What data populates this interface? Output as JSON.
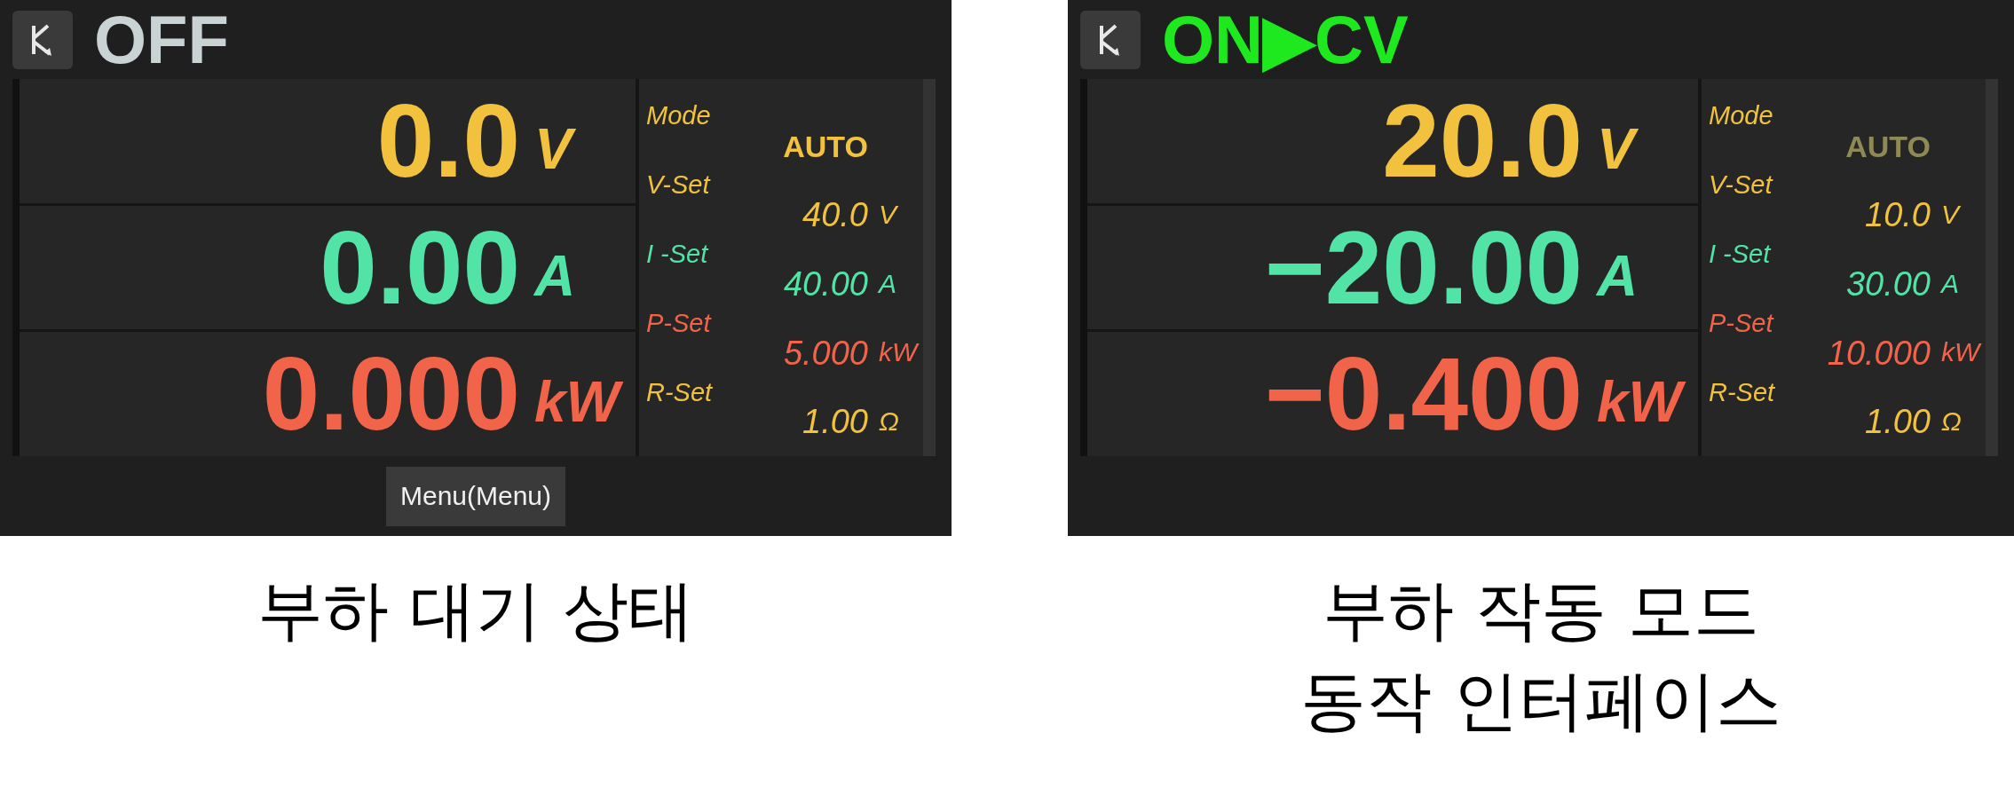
{
  "panels": [
    {
      "status": {
        "text": "OFF",
        "output_on": false
      },
      "readouts": [
        {
          "kind": "voltage",
          "value": "0.0",
          "unit": "V"
        },
        {
          "kind": "current",
          "value": "0.00",
          "unit": "A"
        },
        {
          "kind": "power",
          "value": "0.000",
          "unit": "kW"
        }
      ],
      "setting_labels": [
        {
          "kind": "mode",
          "text": "Mode"
        },
        {
          "kind": "voltage",
          "text": "V-Set"
        },
        {
          "kind": "current",
          "text": "I -Set"
        },
        {
          "kind": "power",
          "text": "P-Set"
        },
        {
          "kind": "resistance",
          "text": "R-Set"
        }
      ],
      "setting_values": [
        {
          "kind": "mode",
          "value": "AUTO",
          "dimmed": false
        },
        {
          "kind": "voltage",
          "value": "40.0",
          "unit": "V"
        },
        {
          "kind": "current",
          "value": "40.00",
          "unit": "A"
        },
        {
          "kind": "power",
          "value": "5.000",
          "unit": "kW"
        },
        {
          "kind": "resistance",
          "value": "1.00",
          "unit": "Ω"
        }
      ],
      "menu_button": "Menu(Menu)",
      "caption": [
        "부하 대기 상태"
      ]
    },
    {
      "status": {
        "text": "ON▶CV",
        "output_on": true
      },
      "readouts": [
        {
          "kind": "voltage",
          "value": "20.0",
          "unit": "V"
        },
        {
          "kind": "current",
          "value": "−20.00",
          "unit": "A"
        },
        {
          "kind": "power",
          "value": "−0.400",
          "unit": "kW"
        }
      ],
      "setting_labels": [
        {
          "kind": "mode",
          "text": "Mode"
        },
        {
          "kind": "voltage",
          "text": "V-Set"
        },
        {
          "kind": "current",
          "text": "I -Set"
        },
        {
          "kind": "power",
          "text": "P-Set"
        },
        {
          "kind": "resistance",
          "text": "R-Set"
        }
      ],
      "setting_values": [
        {
          "kind": "mode",
          "value": "AUTO",
          "dimmed": true
        },
        {
          "kind": "voltage",
          "value": "10.0",
          "unit": "V"
        },
        {
          "kind": "current",
          "value": "30.00",
          "unit": "A"
        },
        {
          "kind": "power",
          "value": "10.000",
          "unit": "kW"
        },
        {
          "kind": "resistance",
          "value": "1.00",
          "unit": "Ω"
        }
      ],
      "caption": [
        "부하 작동 모드",
        "동작 인터페이스"
      ]
    }
  ]
}
